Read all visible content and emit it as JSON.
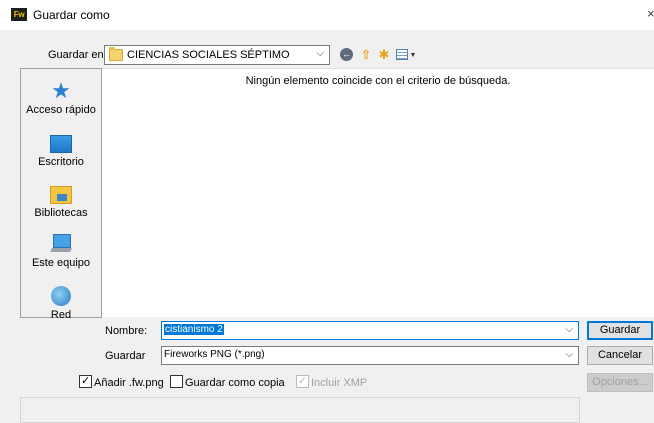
{
  "window": {
    "app_badge": "Fw",
    "title": "Guardar como",
    "close_glyph": "×"
  },
  "toolbar": {
    "save_in_label": "Guardar en:",
    "current_folder": "CIENCIAS SOCIALES SÉPTIMO",
    "dropdown_glyph": "⌵",
    "icons": [
      "back-icon",
      "up-folder-icon",
      "new-folder-icon",
      "view-menu-icon"
    ]
  },
  "places": [
    {
      "label": "Acceso rápido",
      "icon": "quick-access-icon"
    },
    {
      "label": "Escritorio",
      "icon": "desktop-icon"
    },
    {
      "label": "Bibliotecas",
      "icon": "libraries-icon"
    },
    {
      "label": "Este equipo",
      "icon": "this-pc-icon"
    },
    {
      "label": "Red",
      "icon": "network-icon"
    }
  ],
  "filelist": {
    "empty_message": "Ningún elemento coincide con el criterio de búsqueda."
  },
  "form": {
    "name_label": "Nombre:",
    "name_value": "cistianismo 2",
    "type_label": "Guardar",
    "type_value": "Fireworks PNG (*.png)"
  },
  "buttons": {
    "save": "Guardar",
    "cancel": "Cancelar",
    "options": "Opciones..."
  },
  "checkboxes": {
    "add_ext": {
      "label": "Añadir .fw.png",
      "checked": true
    },
    "save_copy": {
      "label": "Guardar como copia",
      "checked": false
    },
    "include_xmp": {
      "label": "Incluir XMP",
      "checked": true,
      "disabled": true
    }
  },
  "colors": {
    "accent": "#0078d7",
    "dialog_bg": "#f0f0f0"
  }
}
